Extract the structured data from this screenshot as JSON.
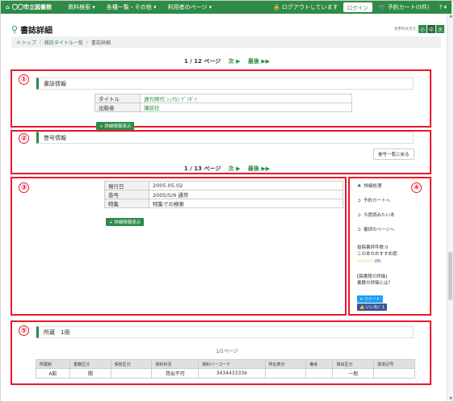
{
  "nav": {
    "brand": "〇〇市立図書館",
    "menus": [
      "資料検索 ▾",
      "各種一覧・その他 ▾",
      "利用者のページ ▾"
    ],
    "login_status": "ログアウトしています",
    "login_button": "ログイン",
    "cart": "予約カート(0件)",
    "help": "? ▾"
  },
  "page": {
    "title": "書誌詳細",
    "fontsize_label": "文字の大きさ",
    "fontsize_options": [
      "小",
      "中",
      "大"
    ]
  },
  "breadcrumb": [
    "トップ",
    "雑誌タイトル一覧",
    "書誌詳細"
  ],
  "pager1": {
    "text": "1 / 12 ページ",
    "next": "次 ▶",
    "last": "最後 ▶▶"
  },
  "markers": [
    "①",
    "②",
    "③",
    "④",
    "⑤"
  ],
  "biblio": {
    "heading": "書誌情報",
    "rows": [
      {
        "label": "タイトル",
        "value": "週刊現代 ｼｭｳｶﾝ ｹﾞﾝﾀﾞｲ"
      },
      {
        "label": "出版者",
        "value": "講談社"
      }
    ],
    "detail_button": "+ 詳細情報表示"
  },
  "issue": {
    "heading": "巻号情報",
    "list_button": "巻号一覧に戻る",
    "pager": {
      "text": "1 / 13 ページ",
      "next": "次 ▶",
      "last": "最後 ▶▶"
    }
  },
  "issue_detail": {
    "rows": [
      {
        "label": "発行日",
        "value": "2005.05.02"
      },
      {
        "label": "巻号",
        "value": "2005/5/9 通常"
      },
      {
        "label": "特集",
        "value": "特集での検索"
      }
    ],
    "detail_button": "+ 詳細情報表示"
  },
  "side": {
    "links": [
      "詳細処理",
      "予約カートへ",
      "今度読みたい本",
      "書評のページへ"
    ],
    "review_count": "投稿書評件数:0",
    "recommend": "この本のおすすめ度:",
    "stars": "☆☆☆☆☆",
    "star_count": "(0)",
    "review_q1": "[図書館の評価]",
    "review_q2": "書籍の評価とは？",
    "tweet": "ツイート",
    "fb": "いいね！1"
  },
  "holdings": {
    "heading": "所蔵　1冊",
    "page": "1/1ページ",
    "columns": [
      "所蔵館",
      "書籍区分",
      "保管区分",
      "資料状況",
      "資料バーコード",
      "所在表示",
      "備考",
      "貸出区分",
      "請求記号"
    ],
    "rows": [
      [
        "A館",
        "閲",
        "",
        "貸出不可",
        "3434433336",
        "",
        "",
        "一般",
        ""
      ]
    ]
  },
  "colors": {
    "brand": "#2e8b46",
    "marker": "#e8192c"
  }
}
